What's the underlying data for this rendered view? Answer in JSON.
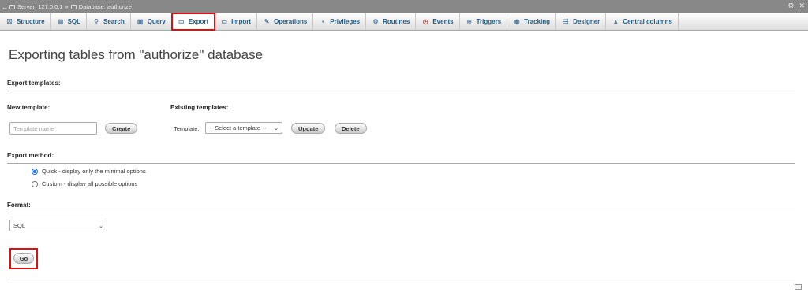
{
  "breadcrumb": {
    "server": "Server: 127.0.0.1",
    "separator": "»",
    "database": "Database: authorize",
    "back_icon": "arrow-left-icon",
    "right_icons": [
      "gear-icon",
      "close-icon"
    ]
  },
  "tabs": [
    {
      "label": "Structure",
      "icon": "structure-icon",
      "glyph": "☒"
    },
    {
      "label": "SQL",
      "icon": "sql-icon",
      "glyph": "▤"
    },
    {
      "label": "Search",
      "icon": "search-icon",
      "glyph": "⚲"
    },
    {
      "label": "Query",
      "icon": "query-icon",
      "glyph": "▣"
    },
    {
      "label": "Export",
      "icon": "export-icon",
      "glyph": "▭",
      "active": true
    },
    {
      "label": "Import",
      "icon": "import-icon",
      "glyph": "▭"
    },
    {
      "label": "Operations",
      "icon": "wrench-icon",
      "glyph": "✎"
    },
    {
      "label": "Privileges",
      "icon": "privileges-icon",
      "glyph": "▪"
    },
    {
      "label": "Routines",
      "icon": "routines-icon",
      "glyph": "⚙"
    },
    {
      "label": "Events",
      "icon": "clock-icon",
      "glyph": "◷"
    },
    {
      "label": "Triggers",
      "icon": "triggers-icon",
      "glyph": "≋"
    },
    {
      "label": "Tracking",
      "icon": "eye-icon",
      "glyph": "◉"
    },
    {
      "label": "Designer",
      "icon": "designer-icon",
      "glyph": "⇶"
    },
    {
      "label": "Central columns",
      "icon": "columns-icon",
      "glyph": "▲"
    }
  ],
  "page_title": "Exporting tables from \"authorize\" database",
  "export_templates": {
    "heading": "Export templates:",
    "new_template_label": "New template:",
    "template_name_placeholder": "Template name",
    "create_button": "Create",
    "existing_templates_label": "Existing templates:",
    "template_label": "Template:",
    "template_select_value": "-- Select a template --",
    "update_button": "Update",
    "delete_button": "Delete"
  },
  "export_method": {
    "heading": "Export method:",
    "options": [
      {
        "label": "Quick - display only the minimal options",
        "checked": true
      },
      {
        "label": "Custom - display all possible options",
        "checked": false
      }
    ]
  },
  "format": {
    "heading": "Format:",
    "selected": "SQL"
  },
  "go_button": "Go",
  "colors": {
    "highlight": "#e01010",
    "tab_text": "#235a81",
    "radio_accent": "#1a73e8"
  }
}
